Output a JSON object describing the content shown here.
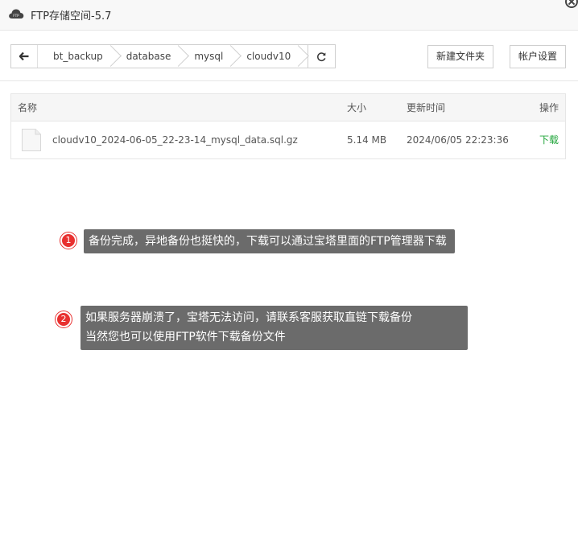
{
  "window": {
    "title": "FTP存储空间-5.7",
    "app_icon_label": "FTP"
  },
  "breadcrumb": {
    "items": [
      "bt_backup",
      "database",
      "mysql",
      "cloudv10"
    ]
  },
  "toolbar": {
    "new_folder_label": "新建文件夹",
    "account_settings_label": "帐户设置"
  },
  "table": {
    "headers": {
      "name": "名称",
      "size": "大小",
      "modified": "更新时间",
      "actions": "操作"
    },
    "rows": [
      {
        "name": "cloudv10_2024-06-05_22-23-14_mysql_data.sql.gz",
        "size": "5.14 MB",
        "modified": "2024/06/05 22:23:36",
        "action": "下载"
      }
    ]
  },
  "annotations": [
    {
      "number": "1",
      "lines": [
        "备份完成，异地备份也挺快的，下载可以通过宝塔里面的FTP管理器下载"
      ]
    },
    {
      "number": "2",
      "lines": [
        "如果服务器崩溃了，宝塔无法访问，请联系客服获取直链下载备份",
        "当然您也可以使用FTP软件下载备份文件"
      ]
    }
  ],
  "colors": {
    "accent_green": "#20a53a",
    "annotation_bg": "#6b6b6b",
    "annotation_dot": "#e8302f"
  }
}
